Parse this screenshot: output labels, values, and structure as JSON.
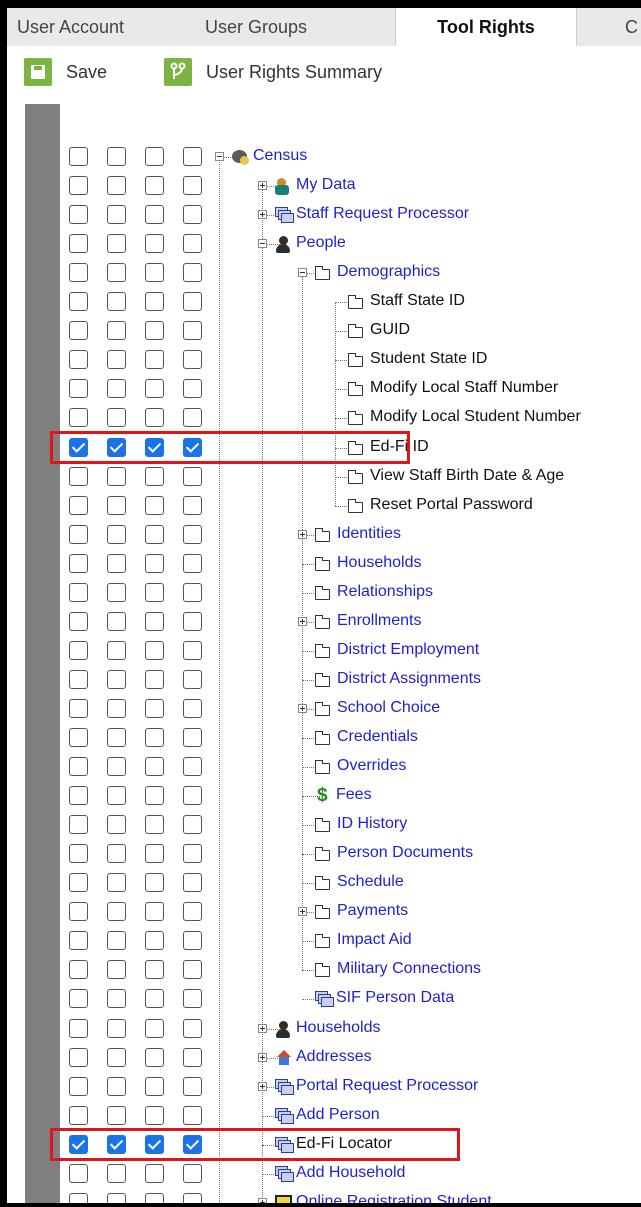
{
  "tabs": [
    {
      "label": "User Account",
      "active": false
    },
    {
      "label": "User Groups",
      "active": false
    },
    {
      "label": "Tool Rights",
      "active": true
    },
    {
      "label": "C",
      "active": false
    }
  ],
  "toolbar": {
    "save_label": "Save",
    "summary_label": "User Rights Summary",
    "save_icon": "save-icon",
    "summary_icon": "branch-icon",
    "accent": "#7cb342"
  },
  "highlight_color": "#e0141b",
  "checkbox_color": "#1a73e8",
  "tree": [
    {
      "label": "Census",
      "depth": 0,
      "expander": "minus",
      "icon": "census",
      "link": true,
      "checked": false
    },
    {
      "label": "My Data",
      "depth": 1,
      "expander": "plus",
      "icon": "mydata",
      "link": true,
      "checked": false
    },
    {
      "label": "Staff Request Processor",
      "depth": 1,
      "expander": "plus",
      "icon": "module",
      "link": true,
      "checked": false
    },
    {
      "label": "People",
      "depth": 1,
      "expander": "minus",
      "icon": "person",
      "link": true,
      "checked": false
    },
    {
      "label": "Demographics",
      "depth": 2,
      "expander": "minus",
      "icon": "folder",
      "link": true,
      "checked": false
    },
    {
      "label": "Staff State ID",
      "depth": 3,
      "expander": "",
      "icon": "folder",
      "link": false,
      "checked": false
    },
    {
      "label": "GUID",
      "depth": 3,
      "expander": "",
      "icon": "folder",
      "link": false,
      "checked": false
    },
    {
      "label": "Student State ID",
      "depth": 3,
      "expander": "",
      "icon": "folder",
      "link": false,
      "checked": false
    },
    {
      "label": "Modify Local Staff Number",
      "depth": 3,
      "expander": "",
      "icon": "folder",
      "link": false,
      "checked": false
    },
    {
      "label": "Modify Local Student Number",
      "depth": 3,
      "expander": "",
      "icon": "folder",
      "link": false,
      "checked": false
    },
    {
      "label": "Ed-Fi ID",
      "depth": 3,
      "expander": "",
      "icon": "folder",
      "link": false,
      "checked": true,
      "highlight": true
    },
    {
      "label": "View Staff Birth Date & Age",
      "depth": 3,
      "expander": "",
      "icon": "folder",
      "link": false,
      "checked": false
    },
    {
      "label": "Reset Portal Password",
      "depth": 3,
      "expander": "",
      "icon": "folder",
      "link": false,
      "checked": false
    },
    {
      "label": "Identities",
      "depth": 2,
      "expander": "plus",
      "icon": "folder",
      "link": true,
      "checked": false
    },
    {
      "label": "Households",
      "depth": 2,
      "expander": "",
      "icon": "folder",
      "link": true,
      "checked": false
    },
    {
      "label": "Relationships",
      "depth": 2,
      "expander": "",
      "icon": "folder",
      "link": true,
      "checked": false
    },
    {
      "label": "Enrollments",
      "depth": 2,
      "expander": "plus",
      "icon": "folder",
      "link": true,
      "checked": false
    },
    {
      "label": "District Employment",
      "depth": 2,
      "expander": "",
      "icon": "folder",
      "link": true,
      "checked": false
    },
    {
      "label": "District Assignments",
      "depth": 2,
      "expander": "",
      "icon": "folder",
      "link": true,
      "checked": false
    },
    {
      "label": "School Choice",
      "depth": 2,
      "expander": "plus",
      "icon": "folder",
      "link": true,
      "checked": false
    },
    {
      "label": "Credentials",
      "depth": 2,
      "expander": "",
      "icon": "folder",
      "link": true,
      "checked": false
    },
    {
      "label": "Overrides",
      "depth": 2,
      "expander": "",
      "icon": "folder",
      "link": true,
      "checked": false
    },
    {
      "label": "Fees",
      "depth": 2,
      "expander": "",
      "icon": "fees",
      "link": true,
      "checked": false
    },
    {
      "label": "ID History",
      "depth": 2,
      "expander": "",
      "icon": "folder",
      "link": true,
      "checked": false
    },
    {
      "label": "Person Documents",
      "depth": 2,
      "expander": "",
      "icon": "folder",
      "link": true,
      "checked": false
    },
    {
      "label": "Schedule",
      "depth": 2,
      "expander": "",
      "icon": "folder",
      "link": true,
      "checked": false
    },
    {
      "label": "Payments",
      "depth": 2,
      "expander": "plus",
      "icon": "folder",
      "link": true,
      "checked": false
    },
    {
      "label": "Impact Aid",
      "depth": 2,
      "expander": "",
      "icon": "folder",
      "link": true,
      "checked": false
    },
    {
      "label": "Military Connections",
      "depth": 2,
      "expander": "",
      "icon": "folder",
      "link": true,
      "checked": false
    },
    {
      "label": "SIF Person Data",
      "depth": 2,
      "expander": "",
      "icon": "module",
      "link": true,
      "checked": false
    },
    {
      "label": "Households",
      "depth": 1,
      "expander": "plus",
      "icon": "person",
      "link": true,
      "checked": false
    },
    {
      "label": "Addresses",
      "depth": 1,
      "expander": "plus",
      "icon": "house",
      "link": true,
      "checked": false
    },
    {
      "label": "Portal Request Processor",
      "depth": 1,
      "expander": "plus",
      "icon": "module",
      "link": true,
      "checked": false
    },
    {
      "label": "Add Person",
      "depth": 1,
      "expander": "",
      "icon": "module",
      "link": true,
      "checked": false
    },
    {
      "label": "Ed-Fi Locator",
      "depth": 1,
      "expander": "",
      "icon": "module",
      "link": false,
      "checked": true,
      "highlight": true
    },
    {
      "label": "Add Household",
      "depth": 1,
      "expander": "",
      "icon": "module",
      "link": true,
      "checked": false
    },
    {
      "label": "Online Registration Student",
      "depth": 1,
      "expander": "plus",
      "icon": "olr",
      "link": true,
      "checked": false
    }
  ]
}
